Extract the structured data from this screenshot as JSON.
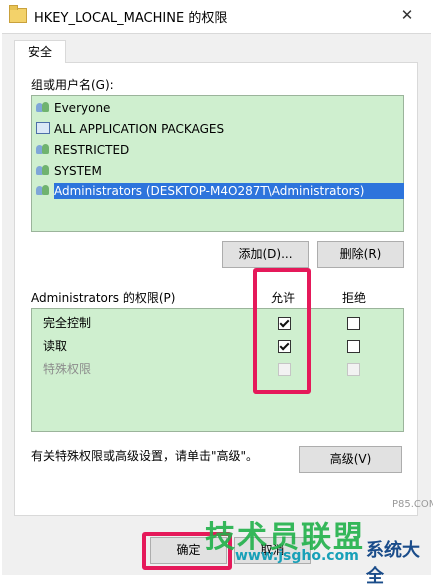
{
  "window": {
    "title": "HKEY_LOCAL_MACHINE 的权限",
    "close_label": "✕"
  },
  "tab": {
    "label": "安全"
  },
  "users": {
    "label": "组或用户名(G):",
    "items": [
      {
        "name": "Everyone",
        "icon": "user-group-icon"
      },
      {
        "name": "ALL APPLICATION PACKAGES",
        "icon": "package-icon"
      },
      {
        "name": "RESTRICTED",
        "icon": "user-group-icon"
      },
      {
        "name": "SYSTEM",
        "icon": "user-group-icon"
      },
      {
        "name": "Administrators (DESKTOP-M4O287T\\Administrators)",
        "icon": "user-group-icon",
        "selected": true
      }
    ]
  },
  "buttons": {
    "add": "添加(D)...",
    "remove": "删除(R)",
    "advanced": "高级(V)",
    "ok": "确定",
    "cancel": "取消"
  },
  "permissions": {
    "header": "Administrators 的权限(P)",
    "allow_header": "允许",
    "deny_header": "拒绝",
    "rows": [
      {
        "name": "完全控制",
        "allow": true,
        "deny": false,
        "enabled": true
      },
      {
        "name": "读取",
        "allow": true,
        "deny": false,
        "enabled": true
      },
      {
        "name": "特殊权限",
        "allow": false,
        "deny": false,
        "enabled": false
      }
    ]
  },
  "advanced_note": "有关特殊权限或高级设置，请单击\"高级\"。",
  "watermark": {
    "main": "技术员联盟",
    "url": "www.jsgho.com",
    "side": "系统大全",
    "small": "P85.COM"
  },
  "colors": {
    "highlight": "#e5195a",
    "list_bg": "#cfefcf",
    "selection": "#2d74dc"
  }
}
